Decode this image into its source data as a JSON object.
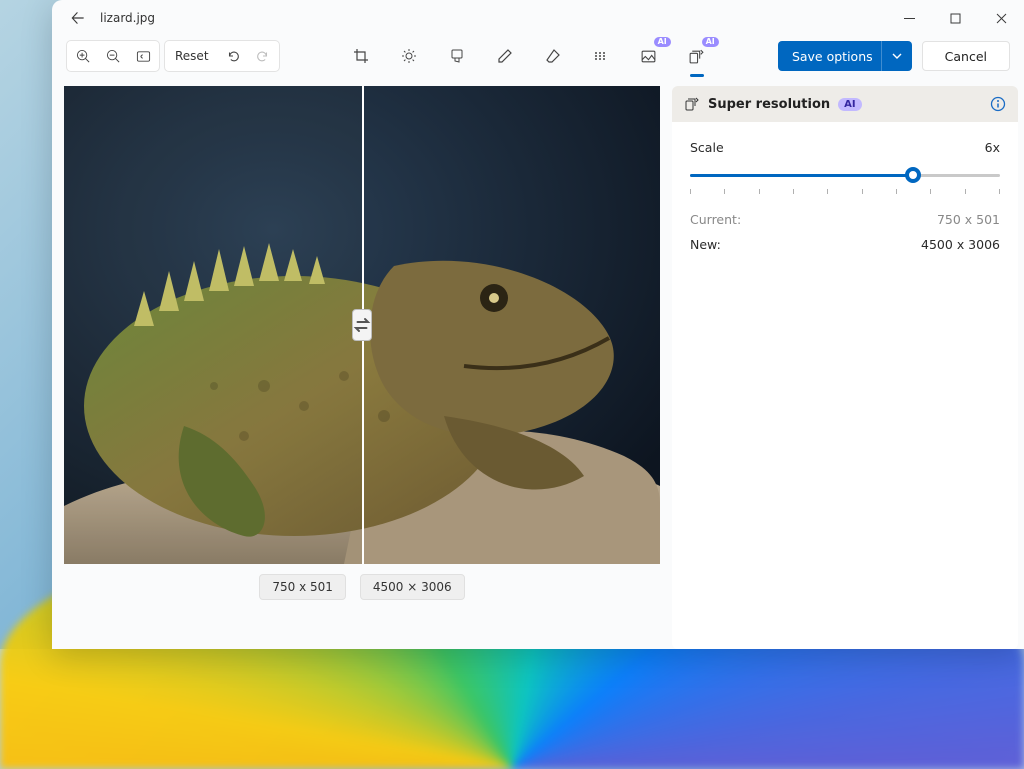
{
  "window": {
    "filename": "lizard.jpg"
  },
  "toolbar": {
    "reset_label": "Reset",
    "save_label": "Save options",
    "cancel_label": "Cancel",
    "ai_badge": "AI"
  },
  "canvas": {
    "left_size_label": "750 x 501",
    "right_size_label": "4500 × 3006"
  },
  "panel": {
    "title": "Super resolution",
    "ai_badge": "AI",
    "scale_label": "Scale",
    "scale_value": "6x",
    "slider_percent": 72,
    "rows": [
      {
        "label": "Current:",
        "value": "750 x 501",
        "muted": true
      },
      {
        "label": "New:",
        "value": "4500 x 3006",
        "muted": false
      }
    ]
  }
}
